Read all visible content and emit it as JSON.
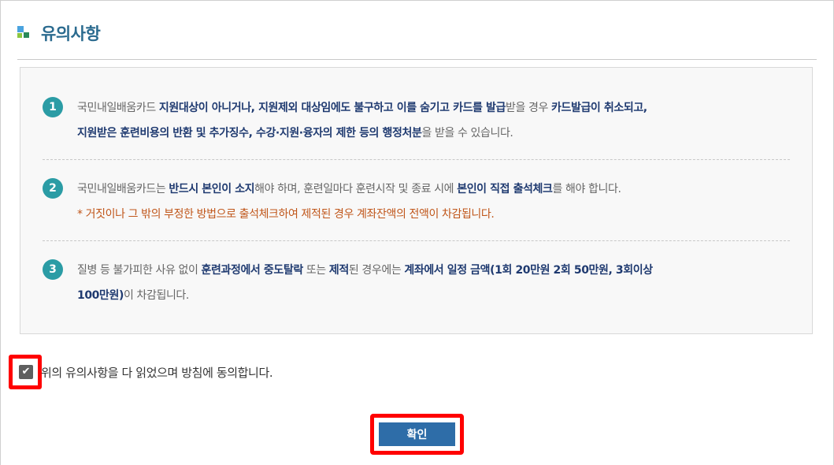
{
  "heading": {
    "title": "유의사항",
    "icon": "heading-bullet-icon"
  },
  "notices": [
    {
      "number": "1",
      "segments": [
        {
          "text": "국민내일배움카드 ",
          "bold": false
        },
        {
          "text": "지원대상이 아니거나, 지원제외 대상임에도 불구하고 이를 숨기고 카드를 발급",
          "bold": true
        },
        {
          "text": "받을 경우 ",
          "bold": false
        },
        {
          "text": "카드발급이 취소되고,",
          "bold": true
        },
        {
          "text": "BR"
        },
        {
          "text": "지원받은 훈련비용의 반환 및 추가징수, 수강·지원·융자의 제한 등의 행정처분",
          "bold": true
        },
        {
          "text": "을 받을 수 있습니다.",
          "bold": false
        }
      ]
    },
    {
      "number": "2",
      "segments": [
        {
          "text": "국민내일배움카드는 ",
          "bold": false
        },
        {
          "text": "반드시 본인이 소지",
          "bold": true
        },
        {
          "text": "해야 하며, 훈련일마다 훈련시작 및 종료 시에 ",
          "bold": false
        },
        {
          "text": "본인이 직접 출석체크",
          "bold": true
        },
        {
          "text": "를 해야 합니다.",
          "bold": false
        },
        {
          "text": "BR"
        },
        {
          "text": "* 거짓이나 그 밖의 부정한 방법으로 출석체크하여 제적된 경우 계좌잔액의 전액이 차감됩니다.",
          "warn": true
        }
      ]
    },
    {
      "number": "3",
      "segments": [
        {
          "text": "질병 등 불가피한 사유 없이 ",
          "bold": false
        },
        {
          "text": "훈련과정에서 중도탈락",
          "bold": true
        },
        {
          "text": " 또는 ",
          "bold": false
        },
        {
          "text": "제적",
          "bold": true
        },
        {
          "text": "된 경우에는 ",
          "bold": false
        },
        {
          "text": "계좌에서 일정 금액(1회 20만원 2회 50만원, 3회이상",
          "bold": true
        },
        {
          "text": "BR"
        },
        {
          "text": "100만원)",
          "bold": true
        },
        {
          "text": "이 차감됩니다.",
          "bold": false
        }
      ]
    }
  ],
  "agreement": {
    "checked": true,
    "label": "위의 유의사항을 다 읽었으며 방침에 동의합니다."
  },
  "confirm": {
    "label": "확인"
  },
  "colors": {
    "accent": "#2b9ca5",
    "button": "#2e6da8",
    "highlight": "#ff0000",
    "emphasis": "#1f3a70",
    "warning": "#c0561a"
  }
}
